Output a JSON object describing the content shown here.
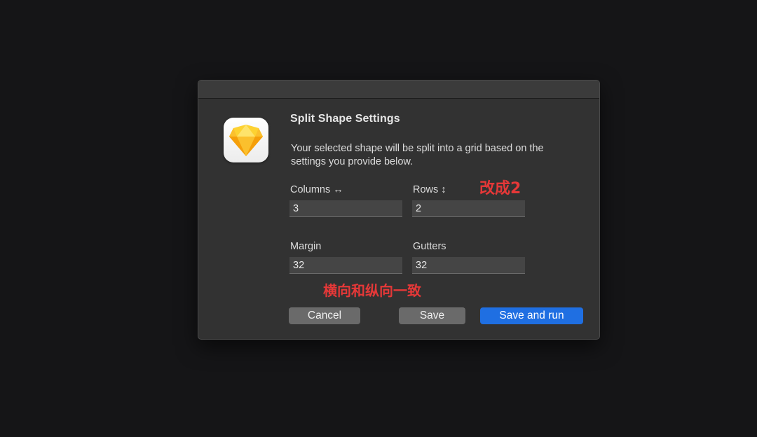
{
  "dialog": {
    "title": "Split Shape Settings",
    "description": "Your selected shape will be split into a grid based on the settings you provide below.",
    "app_icon": "sketch-diamond-icon"
  },
  "fields": {
    "columns": {
      "label": "Columns ↔",
      "value": "3"
    },
    "rows": {
      "label": "Rows ↕",
      "value": "2"
    },
    "margin": {
      "label": "Margin",
      "value": "32"
    },
    "gutters": {
      "label": "Gutters",
      "value": "32"
    }
  },
  "buttons": {
    "cancel": "Cancel",
    "save": "Save",
    "save_and_run": "Save and run"
  },
  "annotations": {
    "rows_note": "改成2",
    "spacing_note": "横向和纵向一致"
  },
  "colors": {
    "primary_button": "#1f6fe2",
    "annotation": "#e53838",
    "diamond_top": "#fdd231",
    "diamond_bottom": "#f59f0a"
  }
}
